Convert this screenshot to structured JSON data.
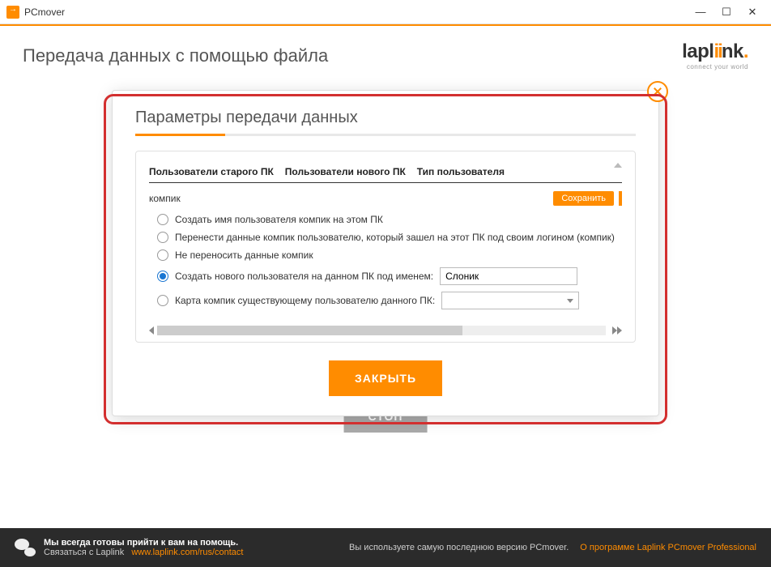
{
  "window": {
    "title": "PCmover"
  },
  "header": {
    "title": "Передача данных с помощью файла",
    "logo_brand": "laplink",
    "logo_tag": "connect your world"
  },
  "modal": {
    "title": "Параметры передачи данных",
    "columns": {
      "old": "Пользователи старого ПК",
      "new": "Пользователи нового ПК",
      "type": "Тип пользователя"
    },
    "user": "компик",
    "save_label": "Сохранить",
    "options": {
      "o1": "Создать имя пользователя компик на этом ПК",
      "o2": "Перенести данные компик пользователю, который зашел на этот ПК под своим логином (компик)",
      "o3": "Не переносить данные компик",
      "o4": "Создать нового пользователя на данном ПК под именем:",
      "o5": "Карта компик существующему пользователю данного ПК:"
    },
    "new_user_value": "Слоник",
    "map_user_value": "",
    "close_label": "ЗАКРЫТЬ"
  },
  "stop_label": "СТОП",
  "footer": {
    "help_bold": "Мы всегда готовы прийти к вам на помощь.",
    "contact_label": "Связаться с Laplink",
    "contact_url": "www.laplink.com/rus/contact",
    "version": "Вы используете самую последнюю версию PCmover.",
    "about": "О программе Laplink PCmover Professional"
  }
}
